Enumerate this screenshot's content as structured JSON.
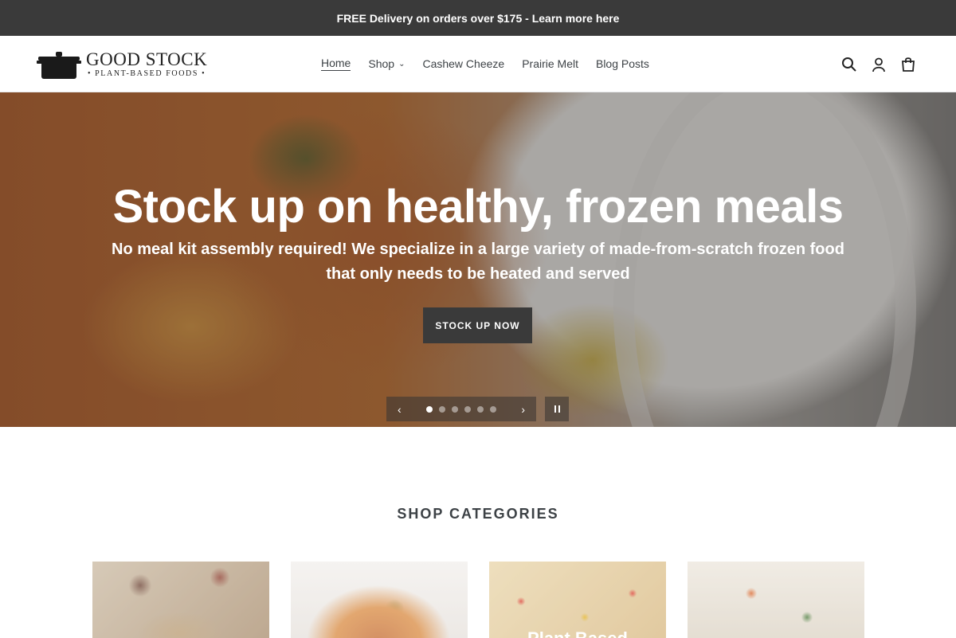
{
  "announcement": {
    "text": "FREE Delivery on orders over $175 - Learn more here"
  },
  "brand": {
    "name": "GOOD STOCK",
    "tagline": "• PLANT-BASED FOODS •",
    "logo_icon": "pot-icon"
  },
  "nav": {
    "items": [
      {
        "label": "Home",
        "active": true
      },
      {
        "label": "Shop",
        "has_dropdown": true
      },
      {
        "label": "Cashew Cheeze"
      },
      {
        "label": "Prairie Melt"
      },
      {
        "label": "Blog Posts"
      }
    ]
  },
  "header_icons": [
    "search-icon",
    "account-icon",
    "cart-icon"
  ],
  "hero": {
    "title": "Stock up on healthy, frozen meals",
    "subtitle_line1": "No meal kit assembly required! We specialize in a large variety of made-from-scratch frozen food",
    "subtitle_line2": "that only needs to be heated and served",
    "button_label": "STOCK UP NOW",
    "slides_total": 6,
    "active_slide": 1
  },
  "categories": {
    "title": "SHOP CATEGORIES",
    "cards": [
      {
        "label": ""
      },
      {
        "label": ""
      },
      {
        "label": "Plant Based"
      },
      {
        "label": ""
      }
    ]
  },
  "colors": {
    "announcement_bg": "#3a3a3a",
    "button_bg": "#3a3a3a",
    "text": "#3d4246"
  }
}
